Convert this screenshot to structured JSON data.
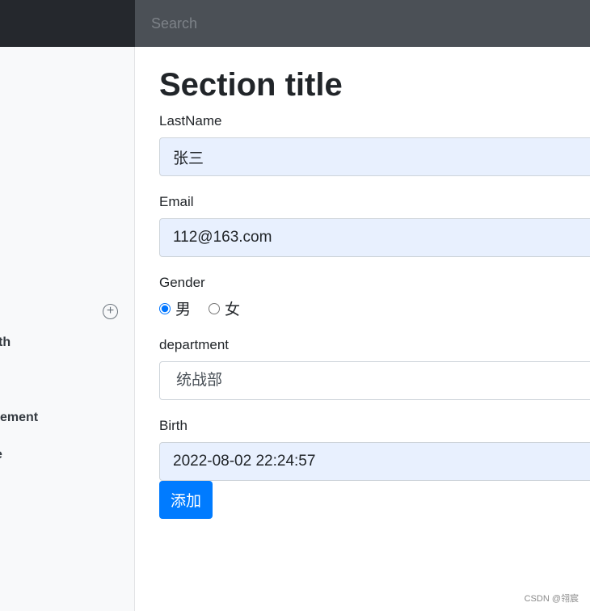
{
  "search": {
    "placeholder": "Search"
  },
  "sidebar": {
    "fragments": [
      "th",
      "ement",
      "e"
    ],
    "add_icon": "plus-circle-icon"
  },
  "main": {
    "title": "Section title",
    "lastname": {
      "label": "LastName",
      "value": "张三"
    },
    "email": {
      "label": "Email",
      "value": "112@163.com"
    },
    "gender": {
      "label": "Gender",
      "options": [
        "男",
        "女"
      ],
      "selected": "男"
    },
    "department": {
      "label": "department",
      "value": "统战部"
    },
    "birth": {
      "label": "Birth",
      "value": "2022-08-02 22:24:57"
    },
    "submit_label": "添加"
  },
  "watermark": "CSDN @翎宸",
  "colors": {
    "primary": "#007bff",
    "navbar": "#343a40"
  }
}
